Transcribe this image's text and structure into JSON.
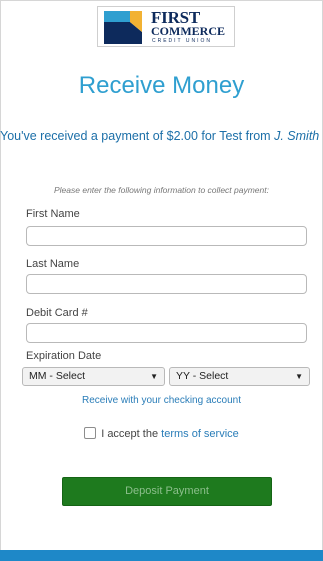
{
  "brand": {
    "line1": "FIRST",
    "line2": "COMMERCE",
    "line3": "CREDIT UNION",
    "colors": {
      "navy": "#0d2a5c",
      "gold": "#f2b233",
      "cyan": "#2f9fd0"
    }
  },
  "page": {
    "title": "Receive Money",
    "message_prefix": "You've received a payment of $2.00 for Test from",
    "message_sender": "J. Smith",
    "instructions": "Please enter the following information to collect payment:"
  },
  "form": {
    "first_name": {
      "label": "First Name",
      "value": ""
    },
    "last_name": {
      "label": "Last Name",
      "value": ""
    },
    "debit_card": {
      "label": "Debit Card #",
      "value": ""
    },
    "expiration": {
      "label": "Expiration Date",
      "month": {
        "selected": "MM - Select",
        "icon": "dropdown-arrow-icon"
      },
      "year": {
        "selected": "YY - Select",
        "icon": "dropdown-arrow-icon"
      }
    },
    "checking_link": "Receive with your checking account",
    "accept_prefix": "I accept the",
    "terms_link": "terms of service",
    "submit_label": "Deposit Payment"
  },
  "colors": {
    "accent": "#2f9fd0",
    "link": "#2a7db8",
    "button": "#1e7a1e",
    "footer": "#1e88c8"
  }
}
